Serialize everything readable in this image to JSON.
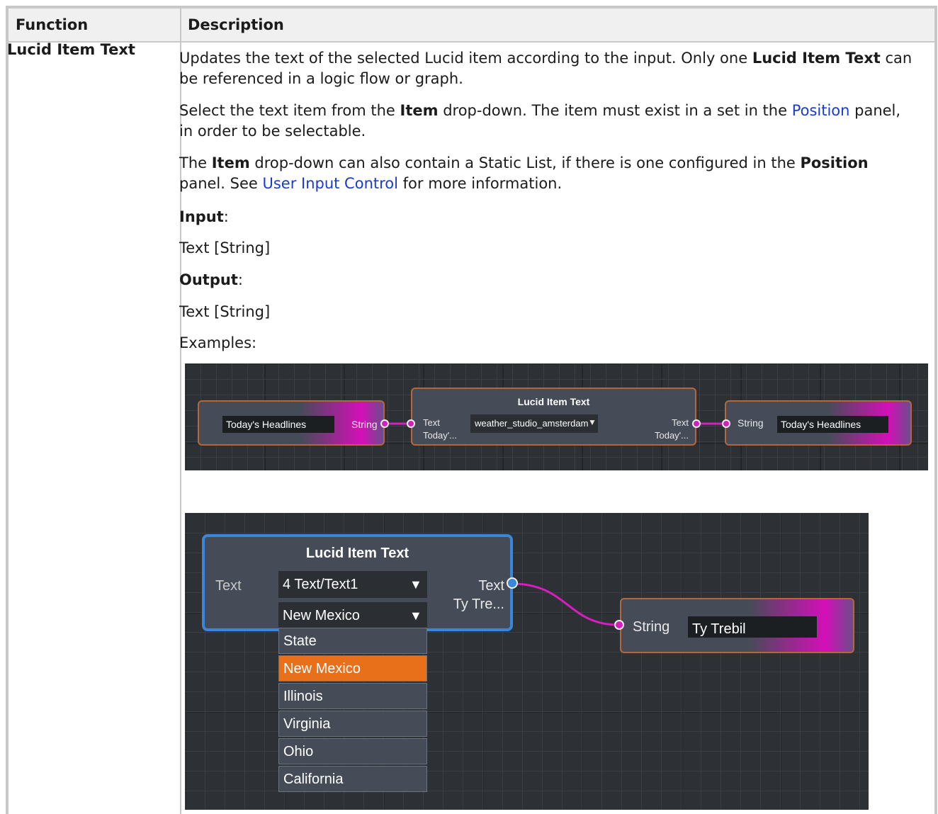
{
  "table": {
    "headers": {
      "function": "Function",
      "description": "Description"
    },
    "row": {
      "function": "Lucid Item Text",
      "p1": {
        "t1": "Updates the text of the selected Lucid item according to the input. Only one ",
        "b1": "Lucid Item Text",
        "t2": " can be referenced in a logic flow or graph."
      },
      "p2": {
        "t1": "Select the text item from the ",
        "b1": "Item",
        "t2": " drop-down. The item must exist in a set in the ",
        "link": "Position",
        "t3": " panel, in order to be selectable."
      },
      "p3": {
        "t1": "The ",
        "b1": "Item",
        "t2": " drop-down can also contain a Static List, if there is one configured in the ",
        "b2": "Position",
        "t3": " panel. See ",
        "link": "User Input Control",
        "t4": " for more information."
      },
      "input_label": "Input",
      "input_value": "Text [String]",
      "output_label": "Output",
      "output_value": "Text [String]",
      "examples": "Examples:"
    }
  },
  "example1": {
    "left_node": {
      "field": "Today's Headlines",
      "port": "String"
    },
    "center_node": {
      "title": "Lucid Item Text",
      "in_label": "Text",
      "in_sub": "Today'...",
      "dropdown": "weather_studio_amsterdam",
      "out_label": "Text",
      "out_sub": "Today'..."
    },
    "right_node": {
      "port": "String",
      "field": "Today's Headlines"
    }
  },
  "example2": {
    "node": {
      "title": "Lucid Item Text",
      "in_label": "Text",
      "dropdown1": "4 Text/Text1",
      "dropdown2": "New Mexico",
      "out_label": "Text",
      "out_sub": "Ty Tre..."
    },
    "options": [
      "State",
      "New Mexico",
      "Illinois",
      "Virginia",
      "Ohio",
      "California"
    ],
    "selected": "New Mexico",
    "string_node": {
      "port": "String",
      "field": "Ty Trebil"
    }
  },
  "colors": {
    "link": "#1a3bd1",
    "wire": "#d51fbd",
    "selected_option": "#e8701a",
    "node_border": "#b4673a",
    "active_border": "#3a86d8"
  }
}
